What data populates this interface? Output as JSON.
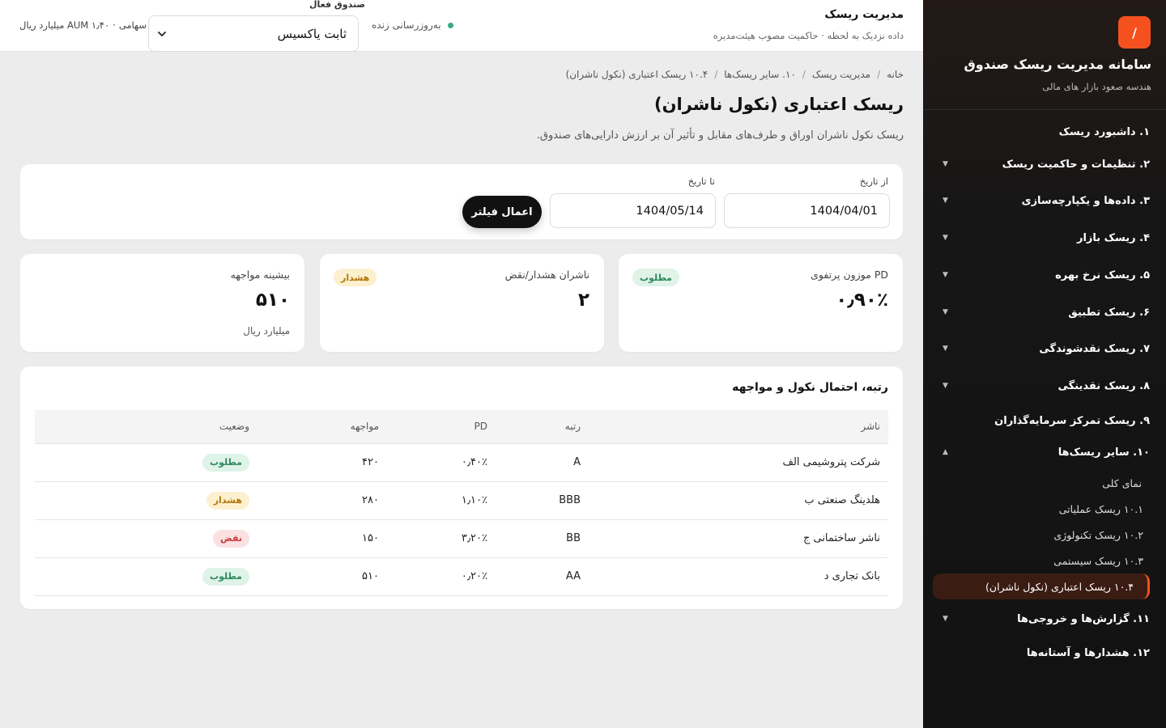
{
  "sidebar": {
    "logo": "/",
    "title": "سامانه مدیریت ریسک صندوق",
    "subtitle": "هندسه صعود بازار های مالی",
    "items": [
      {
        "label": "۱. داشبورد ریسک"
      },
      {
        "label": "۲. تنظیمات و حاکمیت ریسک"
      },
      {
        "label": "۳. داده‌ها و یکپارچه‌سازی"
      },
      {
        "label": "۴. ریسک بازار"
      },
      {
        "label": "۵. ریسک نرخ بهره"
      },
      {
        "label": "۶. ریسک تطبیق"
      },
      {
        "label": "۷. ریسک نقدشوندگی"
      },
      {
        "label": "۸. ریسک نقدینگی"
      },
      {
        "label": "۹. ریسک تمرکز سرمایه‌گذاران"
      },
      {
        "label": "۱۰. سایر ریسک‌ها"
      },
      {
        "label": "۱۱. گزارش‌ها و خروجی‌ها"
      },
      {
        "label": "۱۲. هشدارها و آستانه‌ها"
      }
    ],
    "subitems": [
      {
        "label": "نمای کلی"
      },
      {
        "label": "۱۰.۱ ریسک عملیاتی"
      },
      {
        "label": "۱۰.۲ ریسک تکنولوژی"
      },
      {
        "label": "۱۰.۳ ریسک سیستمی"
      },
      {
        "label": "۱۰.۴ ریسک اعتباری (نکول ناشران)"
      }
    ],
    "caret_down": "▼",
    "caret_up": "▲"
  },
  "topbar": {
    "title": "مدیریت ریسک",
    "subtitle": "داده نزدیک به لحظه · حاکمیت مصوب هیئت‌مدیره",
    "live_label": "به‌روزرسانی زنده",
    "fund_label": "صندوق فعال",
    "fund_value": "ثابت یاکسیس",
    "aum_type": "سهامی",
    "aum_text": "AUM ۱٫۴۰ میلیارد ریال"
  },
  "breadcrumb": [
    "خانه",
    "مدیریت ریسک",
    "۱۰. سایر ریسک‌ها",
    "۱۰.۴ ریسک اعتباری (نکول ناشران)"
  ],
  "page": {
    "title": "ریسک اعتباری (نکول ناشران)",
    "description": "ریسک نکول ناشران اوراق و طرف‌های مقابل و تأثیر آن بر ارزش دارایی‌های صندوق."
  },
  "filter": {
    "from_label": "از تاریخ",
    "from_value": "1404/04/01",
    "to_label": "تا تاریخ",
    "to_value": "1404/05/14",
    "apply_label": "اعمال فیلتر"
  },
  "kpis": [
    {
      "label": "PD موزون پرتفوی",
      "value": "۰٫۹۰٪",
      "badge": "مطلوب"
    },
    {
      "label": "ناشران هشدار/نقض",
      "value": "۲",
      "badge": "هشدار"
    },
    {
      "label": "بیشینه مواجهه",
      "value": "۵۱۰",
      "unit": "میلیارد ریال"
    }
  ],
  "table": {
    "title": "رتبه، احتمال نکول و مواجهه",
    "headers": {
      "name": "ناشر",
      "rating": "رتبه",
      "pd": "PD",
      "exposure": "مواجهه",
      "status": "وضعیت"
    },
    "rows": [
      {
        "name": "شرکت پتروشیمی الف",
        "rating": "A",
        "pd": "۰٫۴۰٪",
        "exposure": "۴۲۰",
        "status": "مطلوب"
      },
      {
        "name": "هلدینگ صنعتی ب",
        "rating": "BBB",
        "pd": "۱٫۱۰٪",
        "exposure": "۲۸۰",
        "status": "هشدار"
      },
      {
        "name": "ناشر ساختمانی ج",
        "rating": "BB",
        "pd": "۳٫۲۰٪",
        "exposure": "۱۵۰",
        "status": "نقض"
      },
      {
        "name": "بانک تجاری د",
        "rating": "AA",
        "pd": "۰٫۲۰٪",
        "exposure": "۵۱۰",
        "status": "مطلوب"
      }
    ]
  },
  "colors": {
    "accent": "#f4511e",
    "ok": "#2f8a5f",
    "warn": "#b3780c",
    "bad": "#c93c3c",
    "live": "#3aaa82"
  },
  "icons": {
    "logo": "slash-logo-icon",
    "dropdown": "chevron-down-icon",
    "live": "status-dot-icon"
  }
}
